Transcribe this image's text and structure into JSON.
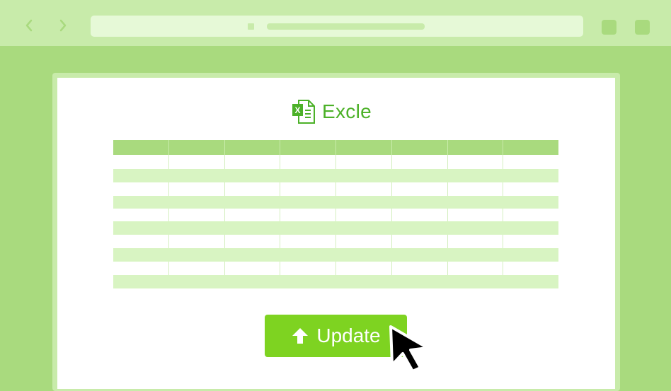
{
  "browser": {
    "back_icon": "chevron-left-icon",
    "forward_icon": "chevron-right-icon",
    "window_controls": [
      "window-button",
      "window-button"
    ]
  },
  "page": {
    "title": "Excle",
    "title_icon": "excel-file-icon",
    "update_button": {
      "label": "Update",
      "icon": "arrow-up-icon"
    },
    "cursor_icon": "mouse-pointer-icon"
  },
  "spreadsheet": {
    "columns": 8,
    "rows": 11
  },
  "colors": {
    "background": "#a9da7e",
    "chrome": "#c8ebaa",
    "address_bar": "#e6f9d7",
    "accent": "#4cb128",
    "button": "#7ed321",
    "header_row": "#a9da7e",
    "stripe_row": "#d8f4c2"
  }
}
